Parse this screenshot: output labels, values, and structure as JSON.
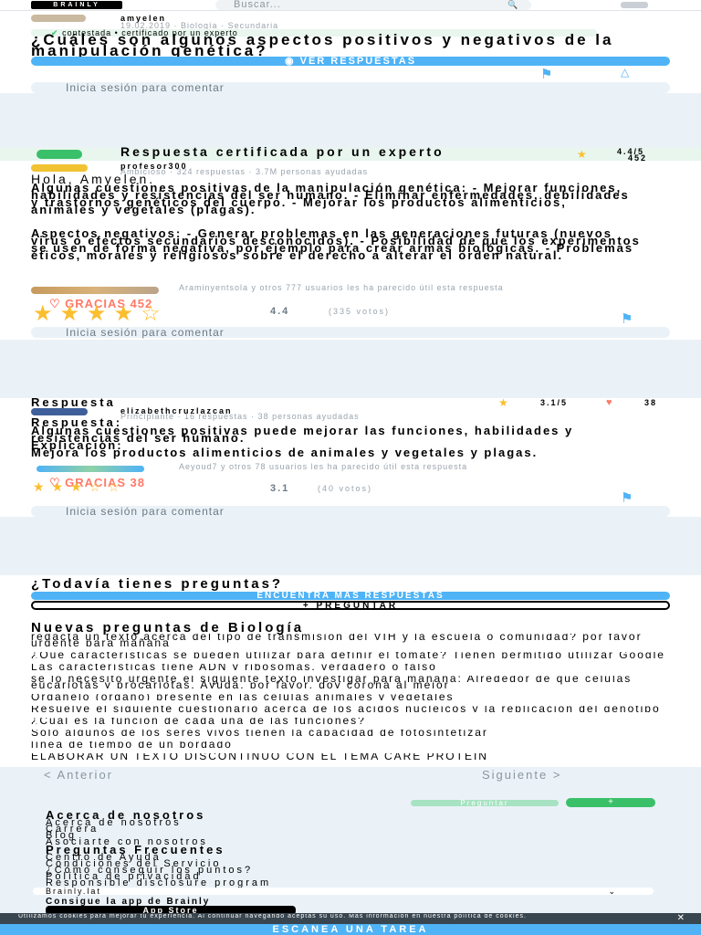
{
  "header": {
    "logo": "BRAINLY",
    "search_placeholder": "Buscar..."
  },
  "question": {
    "author": "amyelen",
    "meta": "19.02.2019 · Biología · Secundaria",
    "certified_note": "contestada • certificado por un experto",
    "title": "¿Cuáles son algunos aspectos positivos y negativos de la manipulación genética?",
    "see_answers": "VER RESPUESTAS",
    "login_comment": "Inicia sesión para comentar"
  },
  "answer1": {
    "badge": "Respuesta certificada por un experto",
    "rating": "4.4/5",
    "thanks_count": "452",
    "author": "profesor300",
    "author_meta": "Ambicioso · 324 respuestas · 3.7M personas ayudadas",
    "greeting": "Hola, Amyelen.",
    "body": "Algunas cuestiones positivas de la manipulación genética: - Mejorar funciones, habilidades y resistencias del ser humano. - Eliminar enfermedades, debilidades y trastornos genéticos del cuerpo. - Mejorar los productos alimenticios, animales y vegetales (plagas).",
    "negatives": "Aspectos negativos: - Generar problemas en las generaciones futuras (nuevos virus o efectos secundarios desconocidos). - Posibilidad de que los experimentos se usen de forma negativa, por ejemplo para crear armas biológicas. - Problemas éticos, morales y religiosos sobre el derecho a alterar el orden natural.",
    "liked": "Araminyentsola y otros 777 usuarios les ha parecido útil esta respuesta",
    "thanks_label": "GRACIAS",
    "thanks_num": "452",
    "score": "4.4",
    "votes": "(335 votos)",
    "login_comment": "Inicia sesión para comentar"
  },
  "answer2": {
    "title": "Respuesta",
    "rating": "3.1/5",
    "hearts": "38",
    "author": "elizabethcruzlazcan",
    "author_meta": "Principiante · 16 respuestas · 38 personas ayudadas",
    "label": "Respuesta:",
    "body": "Algunas cuestiones positivas puede mejorar las funciones, habilidades y resistencias del ser humano.",
    "negative": "Explicación:",
    "body2": "Mejora los productos alimenticios de animales y vegetales y plagas.",
    "liked": "Aeyoud7 y otros 78 usuarios les ha parecido útil esta respuesta",
    "thanks_label": "GRACIAS",
    "thanks_num": "38",
    "score": "3.1",
    "votes": "(40 votos)",
    "login_comment": "Inicia sesión para comentar"
  },
  "cta": {
    "title": "¿Todavía tienes preguntas?",
    "find_more": "ENCUENTRA MÁS RESPUESTAS",
    "ask": "+ PREGUNTAR"
  },
  "new_questions": {
    "title": "Nuevas preguntas de Biología",
    "items": [
      "redacta un texto acerca del tipo de transmisión del VIH y la escuela o comunidad? por favor urgente para mañana",
      "¿Qué características se pueden utilizar para definir el tomate? Tienen permitido utilizar Google",
      "Las características tiene ADN y ribosomas. verdadero o falso",
      "se lo necesito urgente el siguiente texto investigar para mañana: Alrededor de que células eucariotas y procariotas. Ayuda, por favor, doy corona al mejor",
      "Organelo (órgano) presente en las células animales y vegetales",
      "Resuelve el siguiente cuestionario acerca de los ácidos nucleicos y la replicación del genotipo",
      "¿Cuál es la función de cada una de las funciones?",
      "Solo algunos de los seres vivos tienen la capacidad de fotosintetizar",
      "línea de tiempo de un bordado",
      "ELABORAR UN TEXTO DISCONTINUO CON EL TEMA CARE PROTEIN"
    ]
  },
  "pager": {
    "prev": "< Anterior",
    "next": "Siguiente >"
  },
  "footer": {
    "ask_btn": "Preguntar",
    "about_title": "Acerca de nosotros",
    "about_links": [
      "Acerca de nosotros",
      "Carrera",
      "Blog",
      "Asociarte con nosotros"
    ],
    "faq_title": "Preguntas Frecuentes",
    "faq_links": [
      "Centro de Ayuda",
      "Condiciones del Servicio",
      "¿Cómo conseguir los puntos?",
      "Política de privacidad",
      "Responsible disclosure program"
    ],
    "lang": "Brainly.lat",
    "get_app": "Consigue la app de Brainly",
    "store": "App Store",
    "cookie": "Utilizamos cookies para mejorar tu experiencia. Al continuar navegando aceptas su uso. Más información en nuestra política de cookies.",
    "scan": "ESCANEA UNA TAREA"
  }
}
